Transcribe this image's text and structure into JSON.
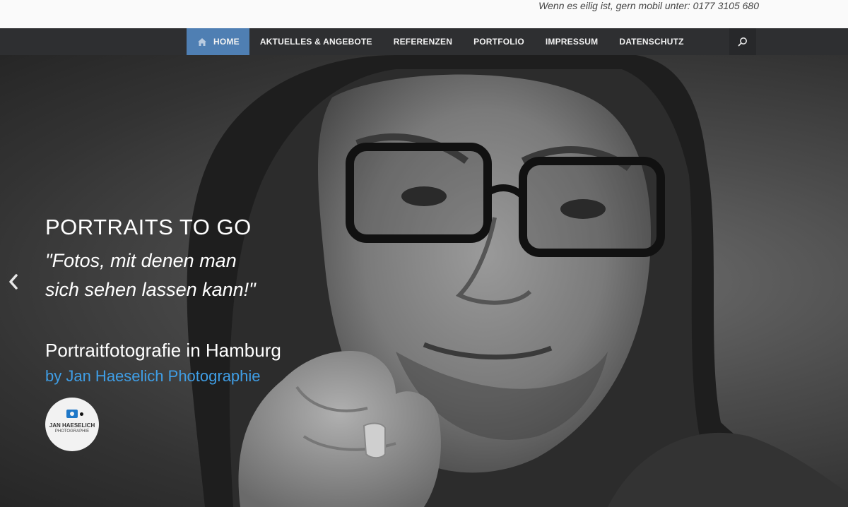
{
  "topbar": {
    "contact": "Wenn es eilig ist, gern mobil unter: 0177 3105 680"
  },
  "nav": {
    "home": "HOME",
    "aktuelles": "AKTUELLES & ANGEBOTE",
    "referenzen": "REFERENZEN",
    "portfolio": "PORTFOLIO",
    "impressum": "IMPRESSUM",
    "datenschutz": "DATENSCHUTZ",
    "search_icon": "search-icon",
    "home_icon": "home-icon"
  },
  "hero": {
    "title": "PORTRAITS TO GO",
    "quote_line1": "\"Fotos, mit denen man",
    "quote_line2": "sich sehen lassen kann!\"",
    "subtitle": "Portraitfotografie in Hamburg",
    "byline": "by Jan Haeselich Photographie",
    "prev_icon": "chevron-left-icon"
  },
  "logo": {
    "name": "JAN HAESELICH",
    "sub": "PHOTOGRAPHIE"
  },
  "colors": {
    "nav_bg": "#2e2f31",
    "nav_active": "#4f7fb3",
    "byline": "#3f9ee6",
    "logo_camera": "#1f78c8"
  }
}
